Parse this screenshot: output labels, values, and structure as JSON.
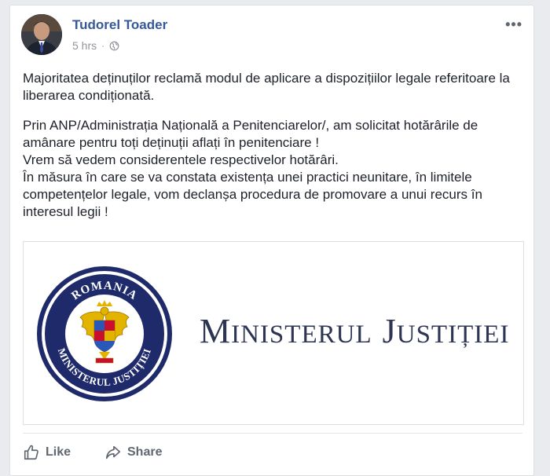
{
  "post": {
    "author": "Tudorel Toader",
    "time": "5 hrs",
    "separator": "·",
    "more_label": "•••",
    "paragraphs": [
      "Majoritatea deținuților reclamă modul de aplicare a dispozițiilor legale referitoare la liberarea condiționată.",
      "Prin ANP/Administrația Națională a Penitenciarelor/, am solicitat hotărârile de amânare pentru toți deținuții aflați în penitenciare !\nVrem să vedem considerentele respectivelor hotărâri.\nÎn măsura în care se va constata existența unei practici neunitare, în limitele competențelor legale, vom declanșa procedura de promovare a unui recurs în interesul legii !"
    ]
  },
  "link_preview": {
    "seal_top_text": "ROMANIA",
    "seal_bottom_text": "MINISTERUL JUSTIȚIEI",
    "title_word1_cap": "M",
    "title_word1_rest": "INISTERUL",
    "title_word2_cap": "J",
    "title_word2_rest": "USTIȚIEI"
  },
  "actions": {
    "like_label": "Like",
    "share_label": "Share"
  },
  "colors": {
    "author_link": "#365899",
    "seal_blue": "#1f2a6b",
    "eagle_gold": "#e2b400",
    "ministry_text": "#2d3552"
  },
  "icons": [
    "globe-icon",
    "more-icon",
    "like-icon",
    "share-icon",
    "romania-coat-of-arms-icon"
  ]
}
